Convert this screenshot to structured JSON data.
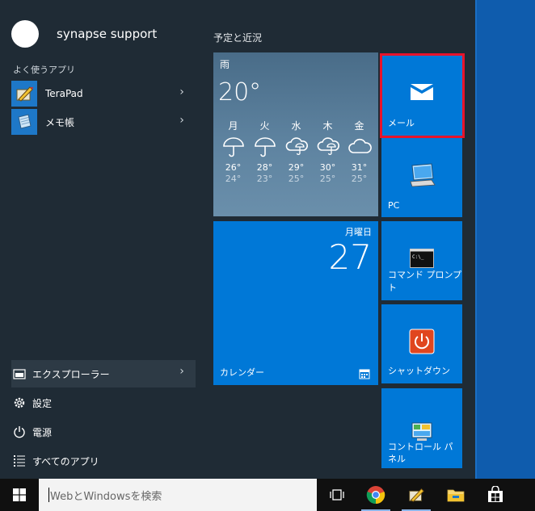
{
  "user": {
    "name": "synapse support"
  },
  "frequent": {
    "label": "よく使うアプリ",
    "items": [
      {
        "label": "TeraPad",
        "icon": "terapad-icon"
      },
      {
        "label": "メモ帳",
        "icon": "notepad-icon"
      }
    ]
  },
  "bottom": {
    "items": [
      {
        "label": "エクスプローラー",
        "icon": "folder-icon"
      },
      {
        "label": "設定",
        "icon": "gear-icon"
      },
      {
        "label": "電源",
        "icon": "power-icon"
      },
      {
        "label": "すべてのアプリ",
        "icon": "list-icon"
      }
    ]
  },
  "tiles": {
    "group_title": "予定と近況",
    "weather": {
      "condition": "雨",
      "temp": "20°",
      "days": [
        {
          "name": "月",
          "hi": "26°",
          "lo": "24°",
          "icon": "umbrella-icon"
        },
        {
          "name": "火",
          "hi": "28°",
          "lo": "23°",
          "icon": "umbrella-icon"
        },
        {
          "name": "水",
          "hi": "29°",
          "lo": "25°",
          "icon": "rain-cloud-icon"
        },
        {
          "name": "木",
          "hi": "30°",
          "lo": "25°",
          "icon": "rain-cloud-icon"
        },
        {
          "name": "金",
          "hi": "31°",
          "lo": "25°",
          "icon": "cloud-icon"
        }
      ]
    },
    "calendar": {
      "weekday": "月曜日",
      "day": "27",
      "label": "カレンダー"
    },
    "mail": {
      "label": "メール"
    },
    "pc": {
      "label": "PC"
    },
    "cmd": {
      "label": "コマンド プロンプト"
    },
    "shutdown": {
      "label": "シャットダウン"
    },
    "cpanel": {
      "label": "コントロール パネル"
    }
  },
  "taskbar": {
    "search_placeholder": "WebとWindowsを検索"
  },
  "colors": {
    "tile_blue": "#0078d7",
    "highlight": "#e8132a",
    "menu_bg": "#1f2b35"
  }
}
